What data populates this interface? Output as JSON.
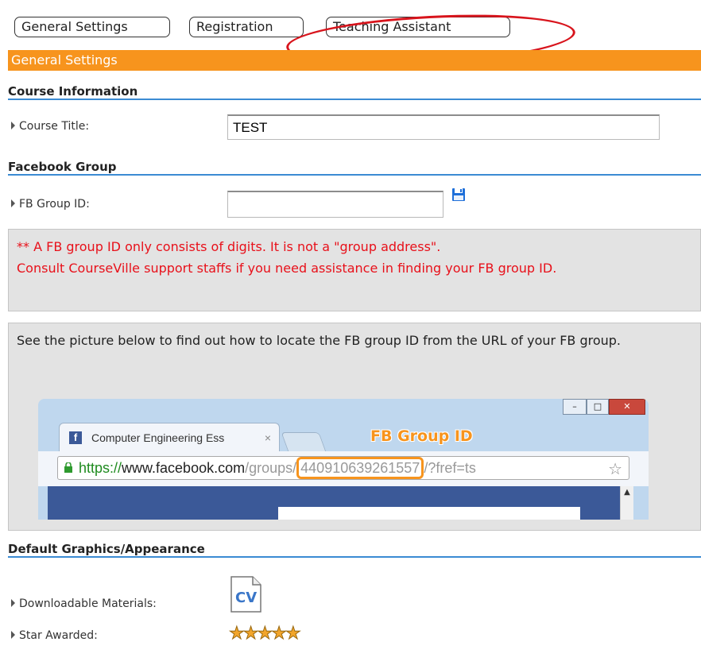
{
  "tabs": [
    {
      "label": "General Settings"
    },
    {
      "label": "Registration"
    },
    {
      "label": "Teaching Assistant"
    }
  ],
  "section_bar": {
    "title": "General Settings"
  },
  "course_info": {
    "heading": "Course Information",
    "title_label": "Course Title:",
    "title_value": "TEST"
  },
  "facebook": {
    "heading": "Facebook Group",
    "group_id_label": "FB Group ID:",
    "group_id_value": "",
    "warning_line1": "** A FB group ID only consists of digits. It is not a \"group address\".",
    "warning_line2": "Consult CourseVille support staffs if you need assistance in finding your FB group ID.",
    "help_text": "See the picture below to find out how to locate the FB group ID from the URL of your FB group."
  },
  "fb_screenshot": {
    "tab_title": "Computer Engineering Ess",
    "tab_close": "×",
    "annotation": "FB Group ID",
    "url_scheme": "https://",
    "url_domain": "www.facebook.com",
    "url_path": "/groups/",
    "url_group_id": "440910639261557",
    "url_query": "/?fref=ts"
  },
  "appearance": {
    "heading": "Default Graphics/Appearance",
    "downloadable_label": "Downloadable Materials:",
    "downloadable_icon_text": "CV",
    "star_label": "Star Awarded:",
    "stars_count": 5
  },
  "colors": {
    "accent_orange": "#f7941d",
    "heading_underline": "#3b8bd3",
    "warning_red": "#e8101a",
    "highlight_red": "#d8141c"
  }
}
